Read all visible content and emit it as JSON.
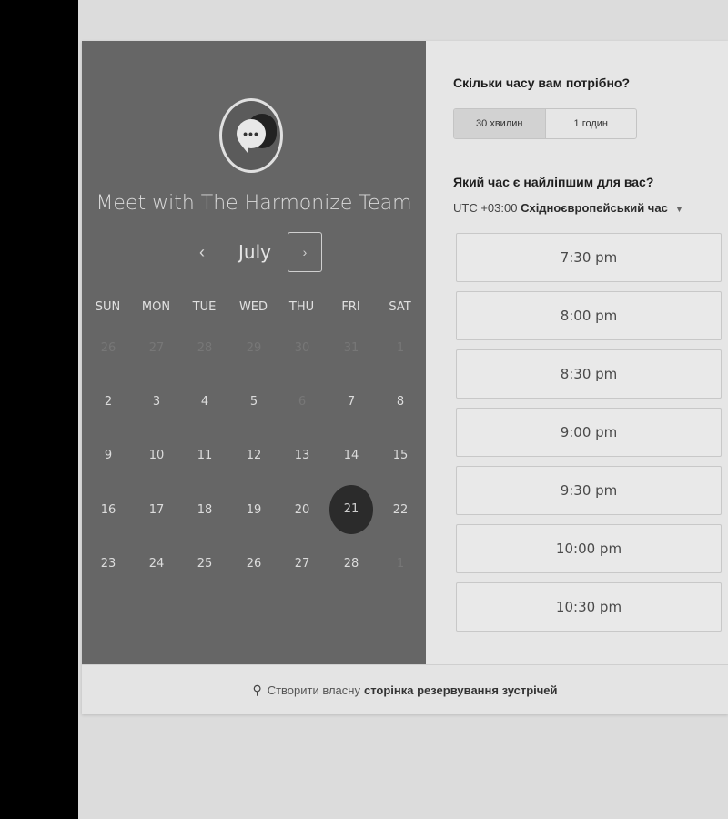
{
  "organizer": {
    "title": "Meet with The Harmonize Team",
    "avatar_icon": "chat-bubble-icon"
  },
  "calendar": {
    "month": "July",
    "prev_label": "‹",
    "next_label": "›",
    "weekdays": [
      "SUN",
      "MON",
      "TUE",
      "WED",
      "THU",
      "FRI",
      "SAT"
    ],
    "weeks": [
      [
        "26",
        "27",
        "28",
        "29",
        "30",
        "31",
        "1"
      ],
      [
        "2",
        "3",
        "4",
        "5",
        "6",
        "7",
        "8"
      ],
      [
        "9",
        "10",
        "11",
        "12",
        "13",
        "14",
        "15"
      ],
      [
        "16",
        "17",
        "18",
        "19",
        "20",
        "21",
        "22"
      ],
      [
        "23",
        "24",
        "25",
        "26",
        "27",
        "28",
        "1"
      ]
    ],
    "selected_day": "21"
  },
  "duration": {
    "question": "Скільки часу вам потрібно?",
    "options": [
      "30 хвилин",
      "1 годин"
    ],
    "selected": "30 хвилин"
  },
  "time": {
    "question": "Який час є найліпшим для вас?",
    "timezone_offset": "UTC +03:00",
    "timezone_name": "Східноєвропейський час",
    "slots": [
      "7:30 pm",
      "8:00 pm",
      "8:30 pm",
      "9:00 pm",
      "9:30 pm",
      "10:00 pm",
      "10:30 pm"
    ]
  },
  "footer": {
    "prefix": "Створити власну",
    "link": "сторінка резервування зустрічей",
    "icon": "hubspot-sprocket-icon"
  },
  "colors": {
    "left_panel": "#666666",
    "right_panel": "#e6e6e6",
    "selected_day_bg": "#2b2b2b"
  }
}
